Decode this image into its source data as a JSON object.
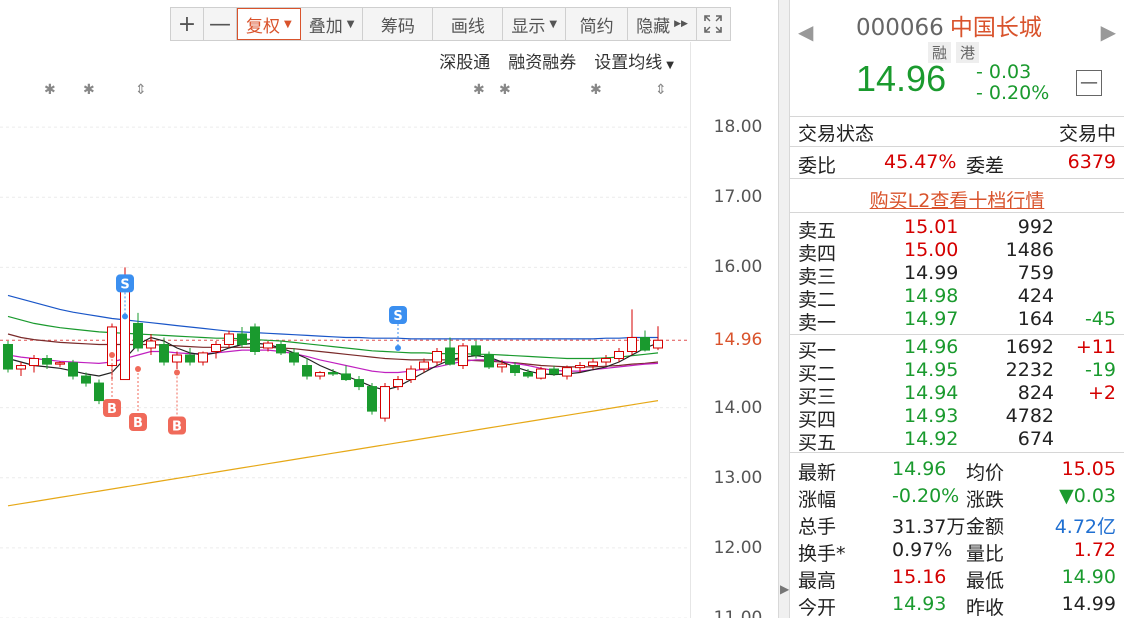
{
  "toolbar": {
    "plus_label": "+",
    "minus_label": "—",
    "fuquan_label": "复权",
    "diejia_label": "叠加",
    "chouma_label": "筹码",
    "huaxian_label": "画线",
    "xianshi_label": "显示",
    "jianyue_label": "简约",
    "yincang_label": "隐藏",
    "expand_icon": "expand-icon"
  },
  "subbar": {
    "shengutong": "深股通",
    "rongzi": "融资融券",
    "junxian": "设置均线"
  },
  "yaxis": {
    "ticks": [
      "18.00",
      "17.00",
      "16.00",
      "14.96",
      "14.00",
      "13.00",
      "12.00",
      "11.00"
    ]
  },
  "markers": {
    "s_label": "S",
    "b_label": "B"
  },
  "chart_data": {
    "type": "candlestick",
    "ylim": [
      11.0,
      18.6
    ],
    "current_price": 14.96,
    "candles": [
      {
        "o": 14.9,
        "h": 14.95,
        "l": 14.5,
        "c": 14.55
      },
      {
        "o": 14.55,
        "h": 14.65,
        "l": 14.45,
        "c": 14.6
      },
      {
        "o": 14.6,
        "h": 14.75,
        "l": 14.5,
        "c": 14.7
      },
      {
        "o": 14.7,
        "h": 14.75,
        "l": 14.55,
        "c": 14.62
      },
      {
        "o": 14.62,
        "h": 14.66,
        "l": 14.58,
        "c": 14.64
      },
      {
        "o": 14.64,
        "h": 14.68,
        "l": 14.4,
        "c": 14.45
      },
      {
        "o": 14.45,
        "h": 14.5,
        "l": 14.3,
        "c": 14.35
      },
      {
        "o": 14.35,
        "h": 14.4,
        "l": 14.05,
        "c": 14.1
      },
      {
        "o": 14.6,
        "h": 15.2,
        "l": 14.4,
        "c": 15.15
      },
      {
        "o": 14.4,
        "h": 16.0,
        "l": 14.4,
        "c": 15.7
      },
      {
        "o": 15.2,
        "h": 15.35,
        "l": 14.8,
        "c": 14.85
      },
      {
        "o": 14.85,
        "h": 15.05,
        "l": 14.75,
        "c": 14.95
      },
      {
        "o": 14.9,
        "h": 15.0,
        "l": 14.6,
        "c": 14.65
      },
      {
        "o": 14.65,
        "h": 14.8,
        "l": 14.55,
        "c": 14.75
      },
      {
        "o": 14.75,
        "h": 14.85,
        "l": 14.6,
        "c": 14.65
      },
      {
        "o": 14.65,
        "h": 14.8,
        "l": 14.6,
        "c": 14.78
      },
      {
        "o": 14.8,
        "h": 14.95,
        "l": 14.7,
        "c": 14.9
      },
      {
        "o": 14.9,
        "h": 15.1,
        "l": 14.85,
        "c": 15.05
      },
      {
        "o": 15.05,
        "h": 15.15,
        "l": 14.85,
        "c": 14.9
      },
      {
        "o": 15.15,
        "h": 15.2,
        "l": 14.75,
        "c": 14.8
      },
      {
        "o": 14.85,
        "h": 14.95,
        "l": 14.8,
        "c": 14.92
      },
      {
        "o": 14.9,
        "h": 14.95,
        "l": 14.75,
        "c": 14.78
      },
      {
        "o": 14.78,
        "h": 14.85,
        "l": 14.6,
        "c": 14.65
      },
      {
        "o": 14.6,
        "h": 14.7,
        "l": 14.4,
        "c": 14.45
      },
      {
        "o": 14.45,
        "h": 14.52,
        "l": 14.4,
        "c": 14.5
      },
      {
        "o": 14.5,
        "h": 14.55,
        "l": 14.45,
        "c": 14.48
      },
      {
        "o": 14.48,
        "h": 14.6,
        "l": 14.38,
        "c": 14.4
      },
      {
        "o": 14.4,
        "h": 14.45,
        "l": 14.25,
        "c": 14.3
      },
      {
        "o": 14.3,
        "h": 14.35,
        "l": 13.9,
        "c": 13.95
      },
      {
        "o": 13.85,
        "h": 14.35,
        "l": 13.8,
        "c": 14.3
      },
      {
        "o": 14.3,
        "h": 14.45,
        "l": 14.25,
        "c": 14.4
      },
      {
        "o": 14.4,
        "h": 14.6,
        "l": 14.35,
        "c": 14.55
      },
      {
        "o": 14.55,
        "h": 14.7,
        "l": 14.5,
        "c": 14.65
      },
      {
        "o": 14.65,
        "h": 14.85,
        "l": 14.6,
        "c": 14.8
      },
      {
        "o": 14.85,
        "h": 15.0,
        "l": 14.6,
        "c": 14.62
      },
      {
        "o": 14.6,
        "h": 14.92,
        "l": 14.55,
        "c": 14.88
      },
      {
        "o": 14.88,
        "h": 14.95,
        "l": 14.7,
        "c": 14.75
      },
      {
        "o": 14.75,
        "h": 14.8,
        "l": 14.55,
        "c": 14.58
      },
      {
        "o": 14.58,
        "h": 14.68,
        "l": 14.5,
        "c": 14.62
      },
      {
        "o": 14.6,
        "h": 14.65,
        "l": 14.45,
        "c": 14.5
      },
      {
        "o": 14.5,
        "h": 14.55,
        "l": 14.42,
        "c": 14.45
      },
      {
        "o": 14.42,
        "h": 14.58,
        "l": 14.4,
        "c": 14.55
      },
      {
        "o": 14.55,
        "h": 14.6,
        "l": 14.45,
        "c": 14.48
      },
      {
        "o": 14.45,
        "h": 14.6,
        "l": 14.4,
        "c": 14.57
      },
      {
        "o": 14.57,
        "h": 14.65,
        "l": 14.5,
        "c": 14.6
      },
      {
        "o": 14.6,
        "h": 14.7,
        "l": 14.55,
        "c": 14.65
      },
      {
        "o": 14.65,
        "h": 14.75,
        "l": 14.6,
        "c": 14.7
      },
      {
        "o": 14.7,
        "h": 14.85,
        "l": 14.65,
        "c": 14.8
      },
      {
        "o": 14.8,
        "h": 15.4,
        "l": 14.75,
        "c": 15.0
      },
      {
        "o": 15.0,
        "h": 15.1,
        "l": 14.8,
        "c": 14.82
      },
      {
        "o": 14.85,
        "h": 15.16,
        "l": 14.82,
        "c": 14.96
      }
    ],
    "ma_lines": [
      {
        "color": "#1a56c8",
        "values": [
          15.6,
          15.55,
          15.5,
          15.45,
          15.4,
          15.36,
          15.33,
          15.3,
          15.27,
          15.25,
          15.23,
          15.21,
          15.19,
          15.17,
          15.15,
          15.13,
          15.11,
          15.09,
          15.08,
          15.07,
          15.06,
          15.05,
          15.04,
          15.03,
          15.02,
          15.01,
          15.0,
          15.0,
          14.99,
          14.99,
          14.99,
          14.98,
          14.98,
          14.98,
          14.98,
          14.98,
          14.98,
          14.98,
          14.98,
          14.98,
          14.98,
          14.98,
          14.98,
          14.98,
          14.98,
          14.98,
          14.99,
          14.99,
          15.0,
          15.0,
          15.0
        ]
      },
      {
        "color": "#1a9a2e",
        "values": [
          15.3,
          15.25,
          15.2,
          15.17,
          15.14,
          15.12,
          15.1,
          15.08,
          15.07,
          15.06,
          15.05,
          15.04,
          15.03,
          15.02,
          15.01,
          15.0,
          14.99,
          14.99,
          14.98,
          14.97,
          14.96,
          14.95,
          14.93,
          14.91,
          14.89,
          14.87,
          14.85,
          14.83,
          14.81,
          14.8,
          14.79,
          14.78,
          14.78,
          14.77,
          14.77,
          14.77,
          14.76,
          14.76,
          14.75,
          14.74,
          14.73,
          14.72,
          14.71,
          14.7,
          14.7,
          14.7,
          14.71,
          14.72,
          14.74,
          14.76,
          14.78
        ]
      },
      {
        "color": "#7a2a2a",
        "values": [
          15.05,
          15.0,
          14.97,
          14.95,
          14.93,
          14.92,
          14.91,
          14.9,
          14.9,
          14.9,
          14.9,
          14.9,
          14.89,
          14.88,
          14.87,
          14.86,
          14.86,
          14.86,
          14.86,
          14.86,
          14.86,
          14.85,
          14.84,
          14.82,
          14.8,
          14.78,
          14.76,
          14.74,
          14.72,
          14.7,
          14.69,
          14.68,
          14.68,
          14.68,
          14.68,
          14.68,
          14.67,
          14.66,
          14.65,
          14.64,
          14.62,
          14.6,
          14.59,
          14.58,
          14.58,
          14.58,
          14.59,
          14.6,
          14.62,
          14.63,
          14.65
        ]
      },
      {
        "color": "#c020c0",
        "values": [
          14.75,
          14.72,
          14.7,
          14.68,
          14.66,
          14.65,
          14.64,
          14.63,
          14.65,
          14.7,
          14.75,
          14.8,
          14.8,
          14.78,
          14.77,
          14.77,
          14.78,
          14.8,
          14.82,
          14.82,
          14.82,
          14.8,
          14.77,
          14.73,
          14.68,
          14.64,
          14.6,
          14.56,
          14.52,
          14.5,
          14.5,
          14.52,
          14.55,
          14.58,
          14.62,
          14.66,
          14.68,
          14.68,
          14.66,
          14.63,
          14.6,
          14.56,
          14.53,
          14.52,
          14.52,
          14.54,
          14.56,
          14.58,
          14.6,
          14.62,
          14.63
        ]
      },
      {
        "color": "#222222",
        "values": [
          14.7,
          14.65,
          14.6,
          14.58,
          14.56,
          14.52,
          14.48,
          14.45,
          14.5,
          14.7,
          14.9,
          15.0,
          14.95,
          14.85,
          14.78,
          14.75,
          14.78,
          14.85,
          14.9,
          14.92,
          14.9,
          14.85,
          14.78,
          14.7,
          14.6,
          14.52,
          14.45,
          14.38,
          14.3,
          14.25,
          14.3,
          14.4,
          14.5,
          14.6,
          14.68,
          14.72,
          14.74,
          14.72,
          14.65,
          14.58,
          14.52,
          14.48,
          14.47,
          14.48,
          14.5,
          14.54,
          14.58,
          14.65,
          14.75,
          14.85,
          14.92
        ]
      },
      {
        "color": "#e6a817",
        "values": [
          12.6,
          12.63,
          12.66,
          12.69,
          12.72,
          12.75,
          12.78,
          12.81,
          12.84,
          12.87,
          12.9,
          12.93,
          12.96,
          12.99,
          13.02,
          13.05,
          13.08,
          13.11,
          13.14,
          13.17,
          13.2,
          13.23,
          13.26,
          13.29,
          13.32,
          13.35,
          13.38,
          13.41,
          13.44,
          13.47,
          13.5,
          13.53,
          13.56,
          13.59,
          13.62,
          13.65,
          13.68,
          13.71,
          13.74,
          13.77,
          13.8,
          13.83,
          13.86,
          13.89,
          13.92,
          13.95,
          13.98,
          14.01,
          14.04,
          14.07,
          14.1
        ]
      }
    ],
    "sell_markers": [
      {
        "candle": 9,
        "price": 15.3
      },
      {
        "candle": 30,
        "price": 14.85
      }
    ],
    "buy_markers": [
      {
        "candle": 8,
        "price": 14.75
      },
      {
        "candle": 10,
        "price": 14.55
      },
      {
        "candle": 13,
        "price": 14.5
      }
    ]
  },
  "quote": {
    "code": "000066",
    "name": "中国长城",
    "tag_rong": "融",
    "tag_gang": "港",
    "price": "14.96",
    "change": "- 0.03",
    "change_pct": "- 0.20%",
    "status_label": "交易状态",
    "status_value": "交易中",
    "weibi_label": "委比",
    "weibi_value": "45.47%",
    "weicha_label": "委差",
    "weicha_value": "6379",
    "l2_link": "购买L2查看十档行情",
    "asks": [
      {
        "label": "卖五",
        "price": "15.01",
        "vol": "992",
        "chg": ""
      },
      {
        "label": "卖四",
        "price": "15.00",
        "vol": "1486",
        "chg": ""
      },
      {
        "label": "卖三",
        "price": "14.99",
        "vol": "759",
        "chg": ""
      },
      {
        "label": "卖二",
        "price": "14.98",
        "vol": "424",
        "chg": ""
      },
      {
        "label": "卖一",
        "price": "14.97",
        "vol": "164",
        "chg": "-45"
      }
    ],
    "bids": [
      {
        "label": "买一",
        "price": "14.96",
        "vol": "1692",
        "chg": "+11"
      },
      {
        "label": "买二",
        "price": "14.95",
        "vol": "2232",
        "chg": "-19"
      },
      {
        "label": "买三",
        "price": "14.94",
        "vol": "824",
        "chg": "+2"
      },
      {
        "label": "买四",
        "price": "14.93",
        "vol": "4782",
        "chg": ""
      },
      {
        "label": "买五",
        "price": "14.92",
        "vol": "674",
        "chg": ""
      }
    ],
    "stats": [
      {
        "l1": "最新",
        "v1": "14.96",
        "l2": "均价",
        "v2": "15.05"
      },
      {
        "l1": "涨幅",
        "v1": "-0.20%",
        "l2": "涨跌",
        "v2": "▼0.03"
      },
      {
        "l1": "总手",
        "v1": "31.37万",
        "l2": "金额",
        "v2": "4.72亿"
      },
      {
        "l1": "换手*",
        "v1": "0.97%",
        "l2": "量比",
        "v2": "1.72"
      },
      {
        "l1": "最高",
        "v1": "15.16",
        "l2": "最低",
        "v2": "14.90"
      },
      {
        "l1": "今开",
        "v1": "14.93",
        "l2": "昨收",
        "v2": "14.99"
      }
    ]
  },
  "colors": {
    "up": "#d40000",
    "down": "#1a9a2e",
    "accent": "#d9532c",
    "sell_marker": "#3b8ff0",
    "buy_marker": "#f06a5a"
  }
}
